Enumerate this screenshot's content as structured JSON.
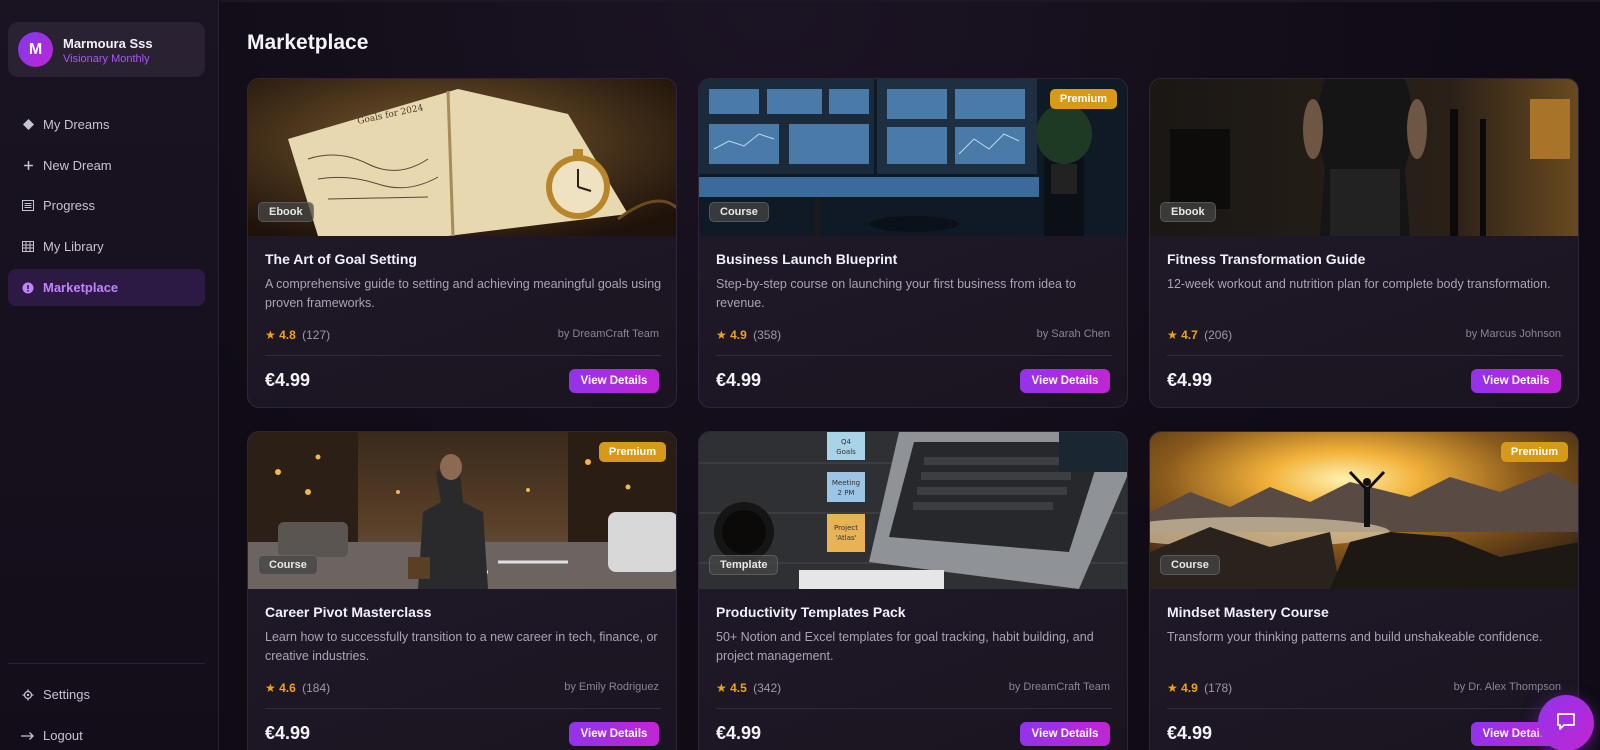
{
  "user": {
    "initial": "M",
    "name": "Marmoura Sss",
    "plan": "Visionary Monthly"
  },
  "sidebar": {
    "items": [
      {
        "label": "My Dreams",
        "icon": "diamond-icon"
      },
      {
        "label": "New Dream",
        "icon": "plus-icon"
      },
      {
        "label": "Progress",
        "icon": "list-icon"
      },
      {
        "label": "My Library",
        "icon": "grid-icon"
      },
      {
        "label": "Marketplace",
        "icon": "compass-icon",
        "active": true
      }
    ],
    "footer": [
      {
        "label": "Settings",
        "icon": "gear-icon"
      },
      {
        "label": "Logout",
        "icon": "logout-arrow-icon"
      }
    ]
  },
  "page": {
    "title": "Marketplace"
  },
  "cards": [
    {
      "title": "The Art of Goal Setting",
      "desc": "A comprehensive guide to setting and achieving meaningful goals using proven frameworks.",
      "type": "Ebook",
      "premium": "",
      "rating": "4.8",
      "reviews": "(127)",
      "author": "by DreamCraft Team",
      "price": "€4.99",
      "button": "View Details"
    },
    {
      "title": "Business Launch Blueprint",
      "desc": "Step-by-step course on launching your first business from idea to revenue.",
      "type": "Course",
      "premium": "Premium",
      "rating": "4.9",
      "reviews": "(358)",
      "author": "by Sarah Chen",
      "price": "€4.99",
      "button": "View Details"
    },
    {
      "title": "Fitness Transformation Guide",
      "desc": "12-week workout and nutrition plan for complete body transformation.",
      "type": "Ebook",
      "premium": "",
      "rating": "4.7",
      "reviews": "(206)",
      "author": "by Marcus Johnson",
      "price": "€4.99",
      "button": "View Details"
    },
    {
      "title": "Career Pivot Masterclass",
      "desc": "Learn how to successfully transition to a new career in tech, finance, or creative industries.",
      "type": "Course",
      "premium": "Premium",
      "rating": "4.6",
      "reviews": "(184)",
      "author": "by Emily Rodriguez",
      "price": "€4.99",
      "button": "View Details"
    },
    {
      "title": "Productivity Templates Pack",
      "desc": "50+ Notion and Excel templates for goal tracking, habit building, and project management.",
      "type": "Template",
      "premium": "",
      "rating": "4.5",
      "reviews": "(342)",
      "author": "by DreamCraft Team",
      "price": "€4.99",
      "button": "View Details"
    },
    {
      "title": "Mindset Mastery Course",
      "desc": "Transform your thinking patterns and build unshakeable confidence.",
      "type": "Course",
      "premium": "Premium",
      "rating": "4.9",
      "reviews": "(178)",
      "author": "by Dr. Alex Thompson",
      "price": "€4.99",
      "button": "View Details"
    }
  ],
  "thumb_text": {
    "notebook": "Goals for 2024",
    "notes": [
      "Q4",
      "Goals",
      "Meeting",
      "2 PM",
      "Project",
      "'Atlas'"
    ]
  },
  "colors": {
    "accent": "#a855f7",
    "premium": "#d69a18",
    "star": "#f0a31a",
    "background": "#0f0b14"
  }
}
